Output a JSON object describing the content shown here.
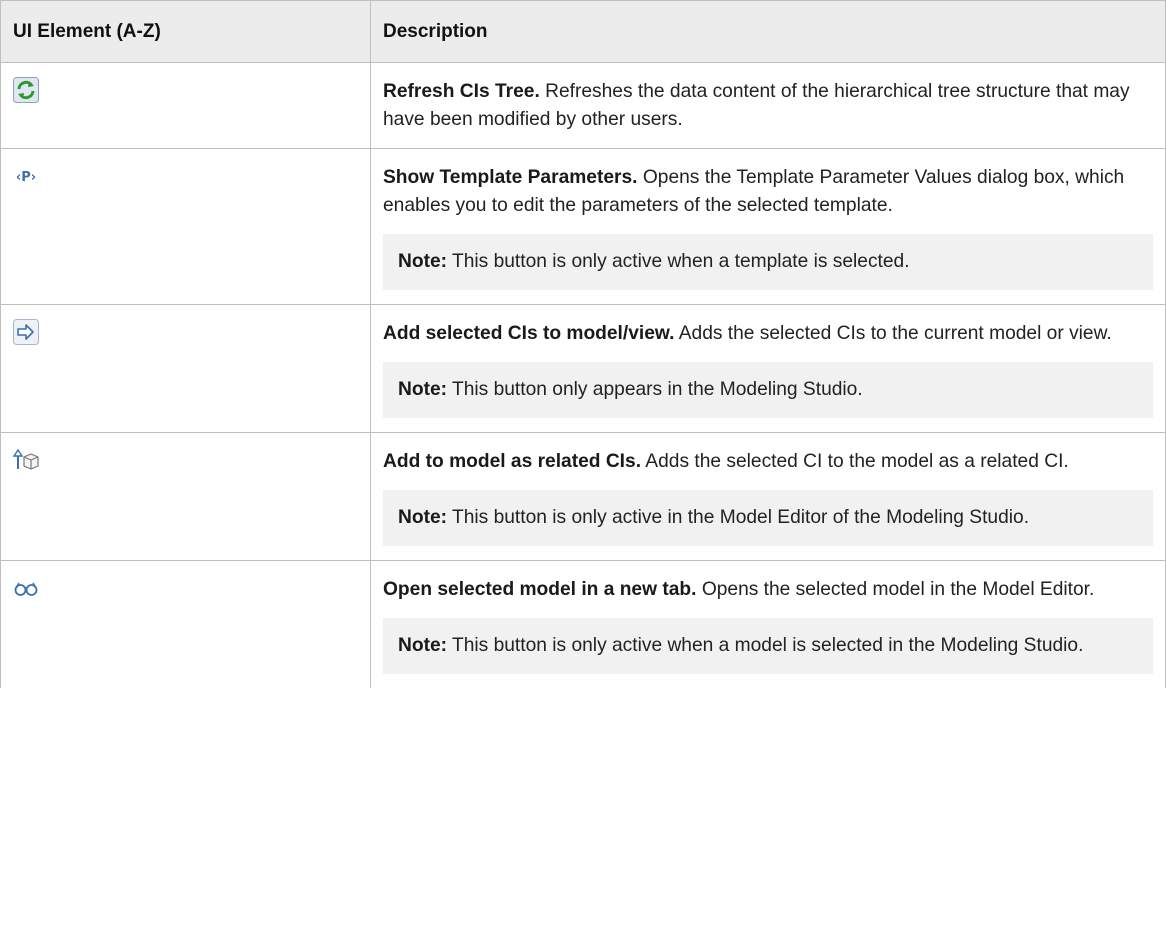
{
  "table": {
    "headers": {
      "element": "UI Element (A-Z)",
      "description": "Description"
    },
    "rows": [
      {
        "icon": "refresh-icon",
        "title": "Refresh CIs Tree.",
        "text": " Refreshes the data content of the hierarchical tree structure that may have been modified by other users.",
        "note_label": "",
        "note_text": ""
      },
      {
        "icon": "template-parameters-icon",
        "title": "Show Template Parameters.",
        "text": " Opens the Template Parameter Values dialog box, which enables you to edit the parameters of the selected template.",
        "note_label": "Note:",
        "note_text": " This button is only active when a template is selected."
      },
      {
        "icon": "arrow-right-icon",
        "title": "Add selected CIs to model/view.",
        "text": " Adds the selected CIs to the current model or view.",
        "note_label": "Note:",
        "note_text": " This button only appears in the Modeling Studio."
      },
      {
        "icon": "add-related-ci-icon",
        "title": "Add to model as related CIs.",
        "text": " Adds the selected CI to the model as a related CI.",
        "note_label": "Note:",
        "note_text": " This button is only active in the Model Editor of the Modeling Studio."
      },
      {
        "icon": "glasses-icon",
        "title": "Open selected model in a new tab.",
        "text": " Opens the selected model in the Model Editor.",
        "note_label": "Note:",
        "note_text": " This button is only active when a model is selected in the Modeling Studio."
      }
    ]
  }
}
